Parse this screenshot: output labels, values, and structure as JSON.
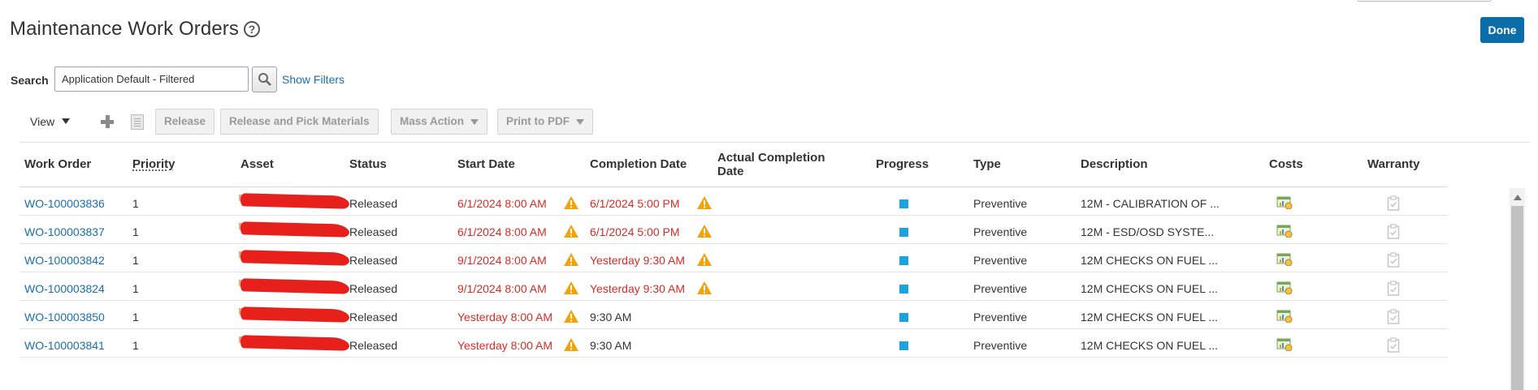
{
  "page": {
    "title": "Maintenance Work Orders",
    "help_glyph": "?",
    "done_label": "Done"
  },
  "search": {
    "label": "Search",
    "value": "Application Default - Filtered",
    "show_filters": "Show Filters"
  },
  "toolbar": {
    "view_label": "View",
    "buttons": [
      "Release",
      "Release and Pick Materials",
      "Mass Action",
      "Print to PDF"
    ]
  },
  "columns": {
    "work_order": "Work Order",
    "priority": "Priority",
    "asset": "Asset",
    "status": "Status",
    "start_date": "Start Date",
    "completion_date": "Completion Date",
    "actual_completion_1": "Actual Completion",
    "actual_completion_2": "Date",
    "progress": "Progress",
    "type": "Type",
    "description": "Description",
    "costs": "Costs",
    "warranty": "Warranty"
  },
  "colors": {
    "link": "#1a6fa8",
    "overdue": "#d42d26",
    "warning": "#f0a30a",
    "progress": "#1aa3dc",
    "primary_button": "#0b6ea8"
  },
  "icons": {
    "help": "help-circle-icon",
    "search": "magnifier-icon",
    "add": "plus-icon",
    "detach": "document-icon",
    "warning": "warning-triangle-icon",
    "costs": "costs-chart-icon",
    "warranty": "clipboard-check-icon"
  },
  "rows": [
    {
      "work_order": "WO-100003836",
      "priority": "1",
      "status": "Released",
      "start": "6/1/2024 8:00 AM",
      "start_warn": true,
      "completion": "6/1/2024 5:00 PM",
      "completion_overdue": true,
      "completion_warn": true,
      "type": "Preventive",
      "description": "12M - CALIBRATION OF ..."
    },
    {
      "work_order": "WO-100003837",
      "priority": "1",
      "status": "Released",
      "start": "6/1/2024 8:00 AM",
      "start_warn": true,
      "completion": "6/1/2024 5:00 PM",
      "completion_overdue": true,
      "completion_warn": true,
      "type": "Preventive",
      "description": "12M - ESD/OSD SYSTE..."
    },
    {
      "work_order": "WO-100003842",
      "priority": "1",
      "status": "Released",
      "start": "9/1/2024 8:00 AM",
      "start_warn": true,
      "completion": "Yesterday 9:30 AM",
      "completion_overdue": true,
      "completion_warn": true,
      "type": "Preventive",
      "description": "12M CHECKS ON FUEL ..."
    },
    {
      "work_order": "WO-100003824",
      "priority": "1",
      "status": "Released",
      "start": "9/1/2024 8:00 AM",
      "start_warn": true,
      "completion": "Yesterday 9:30 AM",
      "completion_overdue": true,
      "completion_warn": true,
      "type": "Preventive",
      "description": "12M CHECKS ON FUEL ..."
    },
    {
      "work_order": "WO-100003850",
      "priority": "1",
      "status": "Released",
      "start": "Yesterday 8:00 AM",
      "start_warn": true,
      "completion": "9:30 AM",
      "completion_overdue": false,
      "completion_warn": false,
      "type": "Preventive",
      "description": "12M CHECKS ON FUEL ..."
    },
    {
      "work_order": "WO-100003841",
      "priority": "1",
      "status": "Released",
      "start": "Yesterday 8:00 AM",
      "start_warn": true,
      "completion": "9:30 AM",
      "completion_overdue": false,
      "completion_warn": false,
      "type": "Preventive",
      "description": "12M CHECKS ON FUEL ..."
    }
  ]
}
